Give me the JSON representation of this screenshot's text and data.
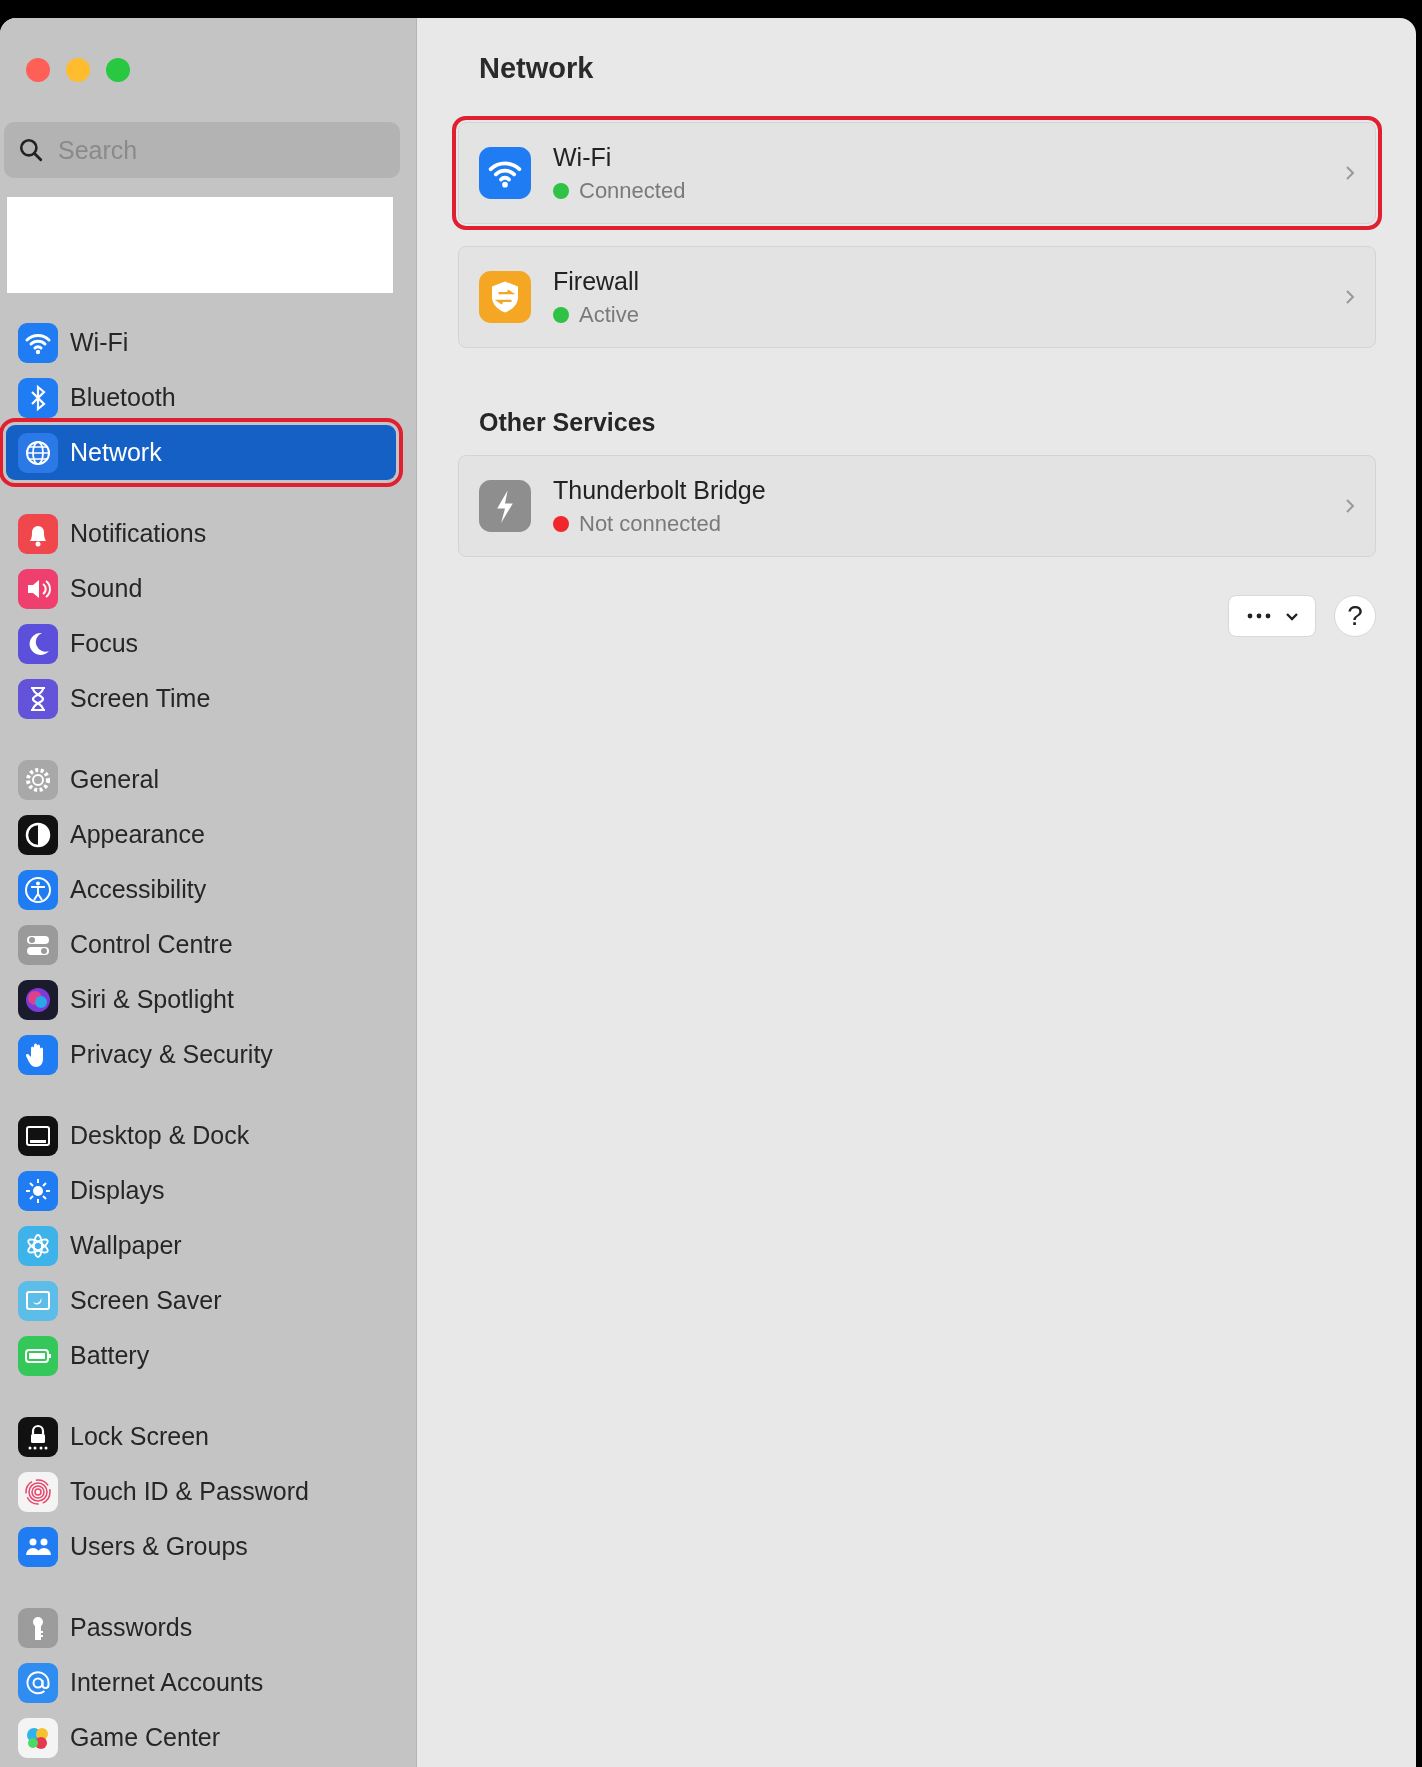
{
  "window": {
    "controls": [
      {
        "color": "#fe5f57"
      },
      {
        "color": "#febc2e"
      },
      {
        "color": "#28c840"
      }
    ]
  },
  "sidebar": {
    "search": {
      "placeholder": "Search"
    },
    "groups": [
      {
        "items": [
          {
            "label": "Wi-Fi",
            "selected": false,
            "highlighted": false
          },
          {
            "label": "Bluetooth",
            "selected": false,
            "highlighted": false
          },
          {
            "label": "Network",
            "selected": true,
            "highlighted": true
          }
        ]
      },
      {
        "items": [
          {
            "label": "Notifications",
            "selected": false,
            "highlighted": false
          },
          {
            "label": "Sound",
            "selected": false,
            "highlighted": false
          },
          {
            "label": "Focus",
            "selected": false,
            "highlighted": false
          },
          {
            "label": "Screen Time",
            "selected": false,
            "highlighted": false
          }
        ]
      },
      {
        "items": [
          {
            "label": "General",
            "selected": false,
            "highlighted": false
          },
          {
            "label": "Appearance",
            "selected": false,
            "highlighted": false
          },
          {
            "label": "Accessibility",
            "selected": false,
            "highlighted": false
          },
          {
            "label": "Control Centre",
            "selected": false,
            "highlighted": false
          },
          {
            "label": "Siri & Spotlight",
            "selected": false,
            "highlighted": false
          },
          {
            "label": "Privacy & Security",
            "selected": false,
            "highlighted": false
          }
        ]
      },
      {
        "items": [
          {
            "label": "Desktop & Dock",
            "selected": false,
            "highlighted": false
          },
          {
            "label": "Displays",
            "selected": false,
            "highlighted": false
          },
          {
            "label": "Wallpaper",
            "selected": false,
            "highlighted": false
          },
          {
            "label": "Screen Saver",
            "selected": false,
            "highlighted": false
          },
          {
            "label": "Battery",
            "selected": false,
            "highlighted": false
          }
        ]
      },
      {
        "items": [
          {
            "label": "Lock Screen",
            "selected": false,
            "highlighted": false
          },
          {
            "label": "Touch ID & Password",
            "selected": false,
            "highlighted": false
          },
          {
            "label": "Users & Groups",
            "selected": false,
            "highlighted": false
          }
        ]
      },
      {
        "items": [
          {
            "label": "Passwords",
            "selected": false,
            "highlighted": false
          },
          {
            "label": "Internet Accounts",
            "selected": false,
            "highlighted": false
          },
          {
            "label": "Game Center",
            "selected": false,
            "highlighted": false
          }
        ]
      }
    ]
  },
  "main": {
    "title": "Network",
    "services": [
      {
        "name": "Wi-Fi",
        "status": "Connected",
        "color": "#30c244",
        "highlighted": true
      },
      {
        "name": "Firewall",
        "status": "Active",
        "color": "#30c244",
        "highlighted": false
      }
    ],
    "other_services": {
      "title": "Other Services",
      "items": [
        {
          "name": "Thunderbolt Bridge",
          "status": "Not connected",
          "color": "#f0282c",
          "highlighted": false
        }
      ]
    },
    "help_button": "?"
  }
}
